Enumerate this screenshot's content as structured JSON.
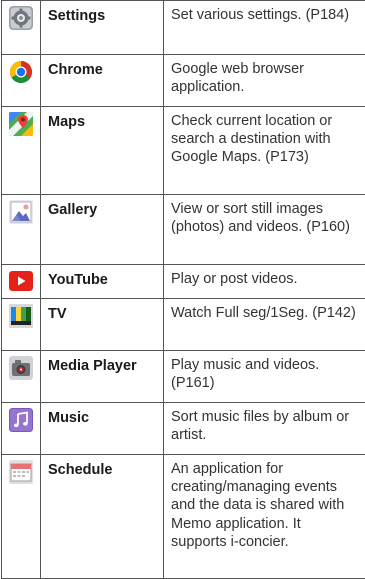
{
  "apps": [
    {
      "icon": "settings-gear-icon",
      "name": "Settings",
      "description": "Set various settings. (P184)"
    },
    {
      "icon": "chrome-icon",
      "name": "Chrome",
      "description": "Google web browser application."
    },
    {
      "icon": "maps-icon",
      "name": "Maps",
      "description": "Check current location or search a destination with Google Maps. (P173)"
    },
    {
      "icon": "gallery-icon",
      "name": "Gallery",
      "description": "View or sort still images (photos) and videos. (P160)"
    },
    {
      "icon": "youtube-icon",
      "name": "YouTube",
      "description": "Play or post videos."
    },
    {
      "icon": "tv-icon",
      "name": "TV",
      "description": "Watch Full seg/1Seg. (P142)"
    },
    {
      "icon": "media-player-icon",
      "name": "Media Player",
      "description": "Play music and videos. (P161)"
    },
    {
      "icon": "music-note-icon",
      "name": "Music",
      "description": "Sort music files by album or artist."
    },
    {
      "icon": "schedule-calendar-icon",
      "name": "Schedule",
      "description": "An application for creating/managing events and the data is shared with Memo application. It supports i-concier."
    }
  ]
}
